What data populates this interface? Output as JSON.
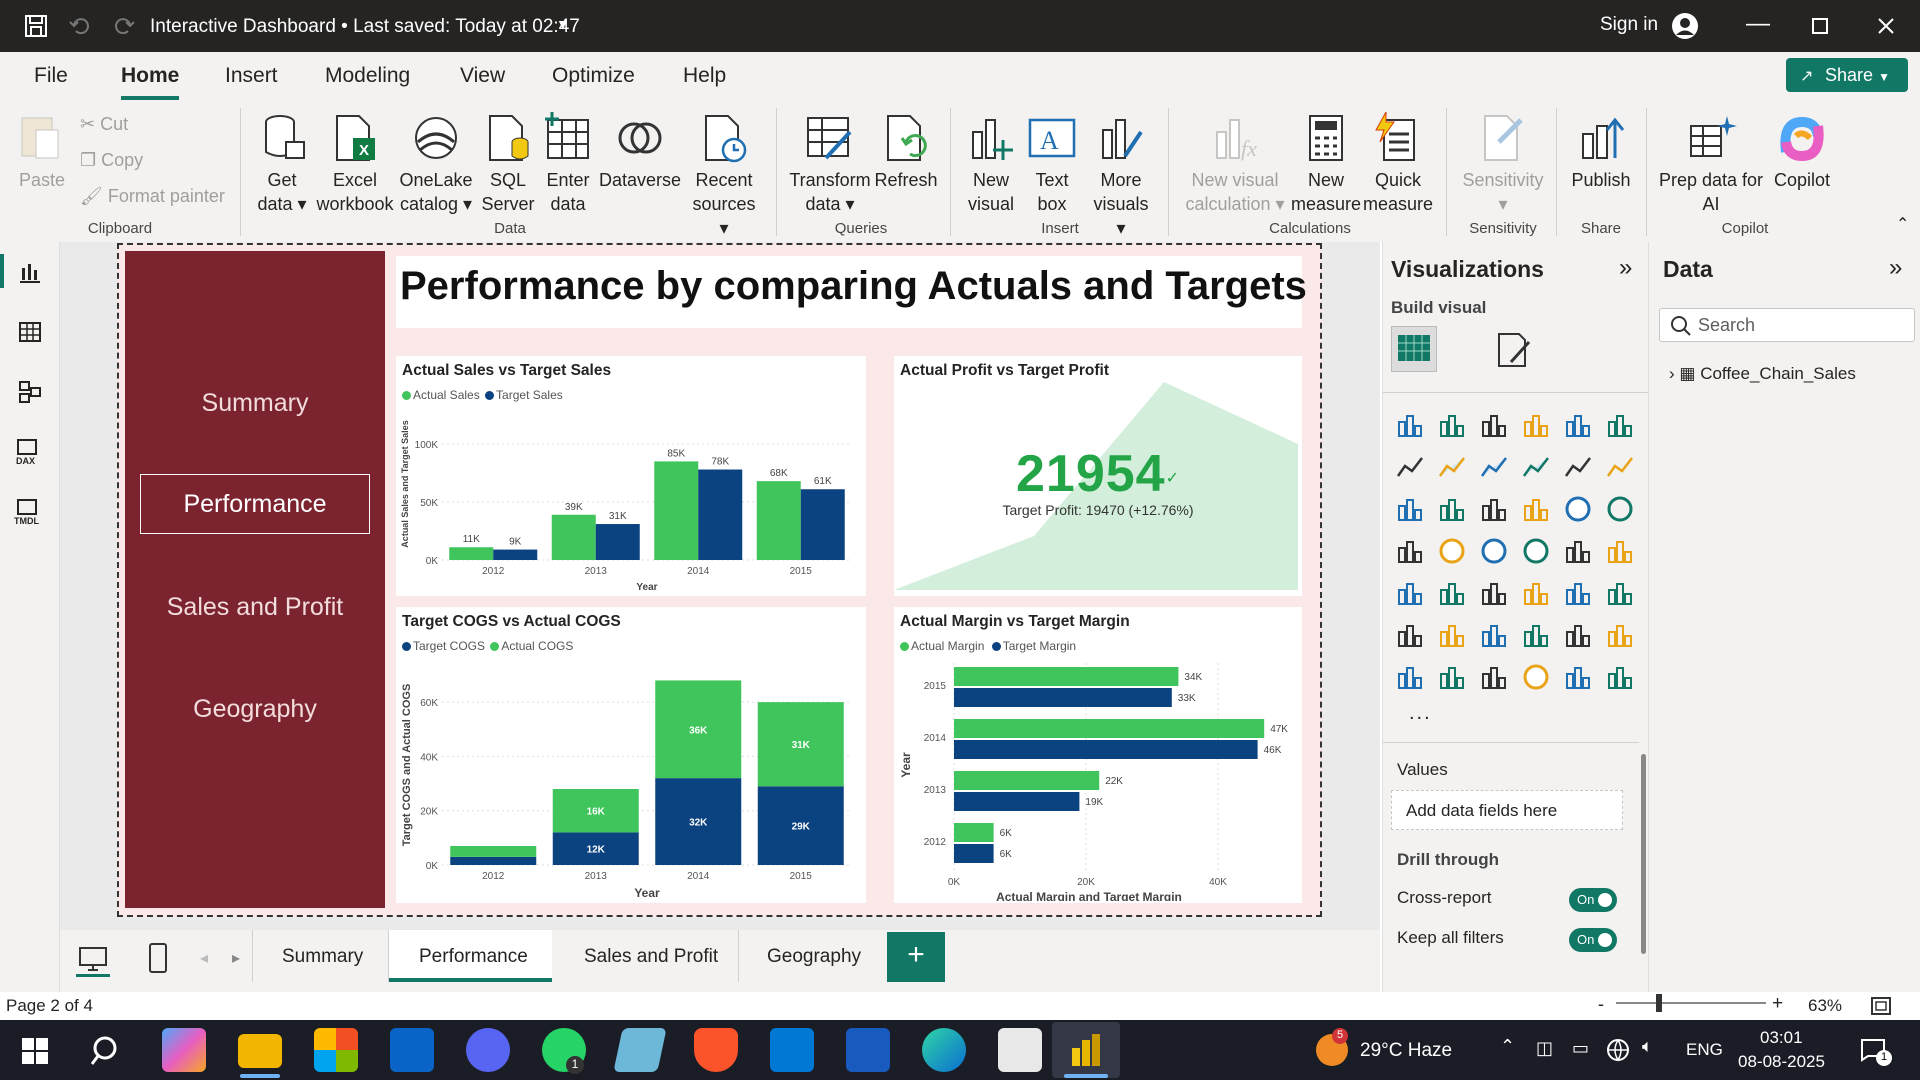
{
  "titlebar": {
    "title": "Interactive Dashboard • Last saved: Today at 02:47",
    "signin": "Sign in"
  },
  "menu": {
    "items": [
      "File",
      "Home",
      "Insert",
      "Modeling",
      "View",
      "Optimize",
      "Help"
    ],
    "share": "Share"
  },
  "ribbon": {
    "clipboard": {
      "paste": "Paste",
      "cut": "Cut",
      "copy": "Copy",
      "format_painter": "Format painter",
      "group": "Clipboard"
    },
    "data": {
      "get_data": [
        "Get",
        "data"
      ],
      "excel": [
        "Excel",
        "workbook"
      ],
      "onelake": [
        "OneLake",
        "catalog"
      ],
      "sql": [
        "SQL",
        "Server"
      ],
      "enter": [
        "Enter",
        "data"
      ],
      "dataverse": "Dataverse",
      "recent": [
        "Recent",
        "sources"
      ],
      "group": "Data"
    },
    "queries": {
      "transform": [
        "Transform",
        "data"
      ],
      "refresh": "Refresh",
      "group": "Queries"
    },
    "insert": {
      "new_visual": [
        "New",
        "visual"
      ],
      "text_box": [
        "Text",
        "box"
      ],
      "more_visuals": [
        "More",
        "visuals"
      ],
      "group": "Insert"
    },
    "calculations": {
      "new_visual_calc": [
        "New visual",
        "calculation"
      ],
      "new_measure": [
        "New",
        "measure"
      ],
      "quick_measure": [
        "Quick",
        "measure"
      ],
      "group": "Calculations"
    },
    "sensitivity": {
      "label": "Sensitivity",
      "group": "Sensitivity"
    },
    "share": {
      "publish": "Publish",
      "group": "Share"
    },
    "copilot": {
      "prep": [
        "Prep data for",
        "AI"
      ],
      "copilot": "Copilot",
      "group": "Copilot"
    }
  },
  "report": {
    "title": "Performance by comparing Actuals and Targets",
    "nav": [
      "Summary",
      "Performance",
      "Sales and Profit",
      "Geography"
    ],
    "kpi": {
      "title": "Actual Profit vs Target Profit",
      "value": "21954",
      "sub": "Target Profit: 19470 (+12.76%)"
    }
  },
  "chart_data": [
    {
      "type": "bar",
      "title": "Actual Sales vs Target Sales",
      "xlabel": "Year",
      "ylabel": "Actual Sales and Target Sales",
      "categories": [
        "2012",
        "2013",
        "2014",
        "2015"
      ],
      "series": [
        {
          "name": "Actual Sales",
          "values": [
            11,
            39,
            85,
            68
          ],
          "labels": [
            "11K",
            "39K",
            "85K",
            "68K"
          ],
          "color": "#3fc55b"
        },
        {
          "name": "Target Sales",
          "values": [
            9,
            31,
            78,
            61
          ],
          "labels": [
            "9K",
            "31K",
            "78K",
            "61K"
          ],
          "color": "#0b4280"
        }
      ],
      "ylim": [
        0,
        100
      ],
      "yticks": [
        "0K",
        "50K",
        "100K"
      ]
    },
    {
      "type": "area",
      "title": "Actual Profit vs Target Profit"
    },
    {
      "type": "bar",
      "stacked": true,
      "title": "Target COGS vs Actual COGS",
      "xlabel": "Year",
      "ylabel": "Target COGS and Actual COGS",
      "categories": [
        "2012",
        "2013",
        "2014",
        "2015"
      ],
      "series": [
        {
          "name": "Target COGS",
          "values": [
            3,
            12,
            32,
            29
          ],
          "labels": [
            "",
            "12K",
            "32K",
            "29K"
          ],
          "color": "#0b4280"
        },
        {
          "name": "Actual COGS",
          "values": [
            4,
            16,
            36,
            31
          ],
          "labels": [
            "",
            "16K",
            "36K",
            "31K"
          ],
          "color": "#3fc55b"
        }
      ],
      "ylim": [
        0,
        70
      ],
      "yticks": [
        "0K",
        "20K",
        "40K",
        "60K"
      ]
    },
    {
      "type": "bar",
      "orientation": "horizontal",
      "title": "Actual Margin vs Target Margin",
      "xlabel": "Actual Margin and Target Margin",
      "ylabel": "Year",
      "categories": [
        "2015",
        "2014",
        "2013",
        "2012"
      ],
      "series": [
        {
          "name": "Actual Margin",
          "values": [
            34,
            47,
            22,
            6
          ],
          "labels": [
            "34K",
            "47K",
            "22K",
            "6K"
          ],
          "color": "#3fc55b"
        },
        {
          "name": "Target Margin",
          "values": [
            33,
            46,
            19,
            6
          ],
          "labels": [
            "33K",
            "46K",
            "19K",
            "6K"
          ],
          "color": "#0b4280"
        }
      ],
      "xlim": [
        0,
        50
      ],
      "xticks": [
        "0K",
        "20K",
        "40K"
      ]
    }
  ],
  "viz": {
    "title": "Visualizations",
    "build": "Build visual",
    "values": "Values",
    "add_fields": "Add data fields here",
    "drill": "Drill through",
    "cross": "Cross-report",
    "keep": "Keep all filters",
    "on": "On",
    "more": "..."
  },
  "data_pane": {
    "title": "Data",
    "search": "Search",
    "table": "Coffee_Chain_Sales"
  },
  "tabs": [
    "Summary",
    "Performance",
    "Sales and Profit",
    "Geography"
  ],
  "status": {
    "page": "Page 2 of 4",
    "zoom": "63%"
  },
  "taskbar": {
    "weather": "29°C  Haze",
    "lang": "ENG",
    "time": "03:01",
    "date": "08-08-2025",
    "badge": "5",
    "notif": "1",
    "wa": "1"
  },
  "colors": {
    "green": "#3fc55b",
    "navy": "#0b4280",
    "maroon": "#7b2430",
    "powerbi": "#f2c811",
    "share": "#117865"
  }
}
